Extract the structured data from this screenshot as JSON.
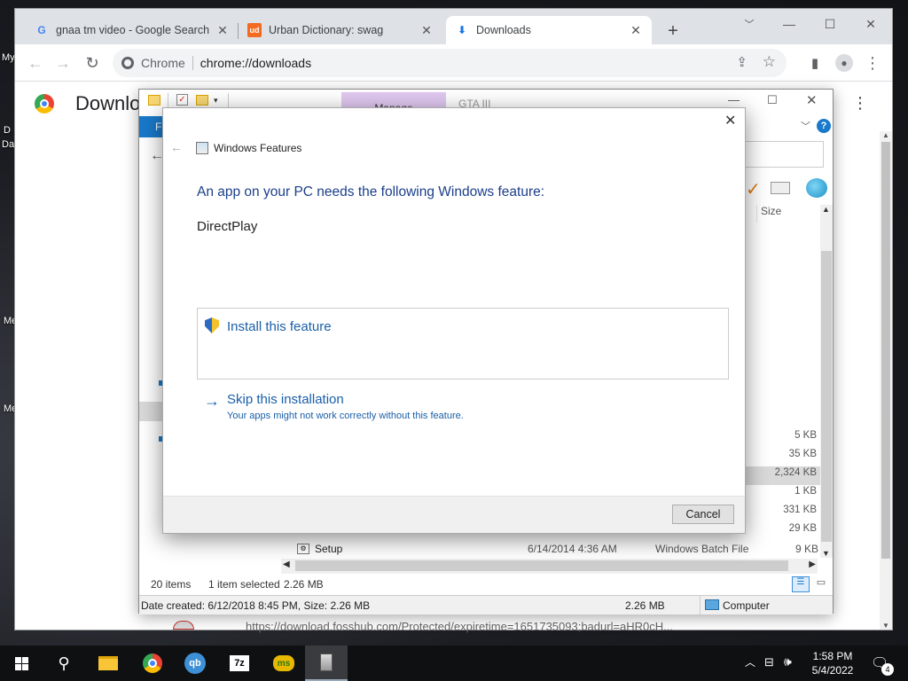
{
  "desktop": {
    "labels": [
      "My",
      "D",
      "Da",
      "Me",
      "Me"
    ]
  },
  "browser": {
    "tabs": [
      {
        "title": "gnaa tm video - Google Search",
        "fav": "G"
      },
      {
        "title": "Urban Dictionary: swag",
        "fav": "ud"
      },
      {
        "title": "Downloads",
        "fav": "⬇"
      }
    ],
    "new_tab": "+",
    "omnibox": {
      "site": "Chrome",
      "url": "chrome://downloads"
    },
    "page": {
      "heading": "Downlo",
      "download_url": "https://download.fosshub.com/Protected/expiretime=1651735093;badurl=aHR0cH..."
    }
  },
  "explorer": {
    "manage": "Manage",
    "location": "GTA III",
    "filetab": "F",
    "col_size": "Size",
    "sizes": [
      "5 KB",
      "35 KB",
      "2,324 KB",
      "1 KB",
      "331 KB",
      "29 KB",
      "9 KB"
    ],
    "setup_row": {
      "name": "Setup",
      "date": "6/14/2014 4:36 AM",
      "type": "Windows Batch File",
      "size": "9 KB"
    },
    "status": {
      "items": "20 items",
      "selected": "1 item selected",
      "size": "2.26 MB"
    },
    "details": {
      "created": "Date created: 6/12/2018 8:45 PM, Size: 2.26 MB",
      "size": "2.26 MB",
      "location": "Computer"
    }
  },
  "dialog": {
    "title": "Windows Features",
    "heading": "An app on your PC needs the following Windows feature:",
    "feature": "DirectPlay",
    "install": "Install this feature",
    "skip": "Skip this installation",
    "skip_note": "Your apps might not work correctly without this feature.",
    "cancel": "Cancel"
  },
  "taskbar": {
    "time": "1:58 PM",
    "date": "5/4/2022",
    "notif_count": "4"
  },
  "colors": {
    "accent": "#1a5fa8",
    "manage": "#e0c8f0",
    "filetab": "#1979ca"
  }
}
